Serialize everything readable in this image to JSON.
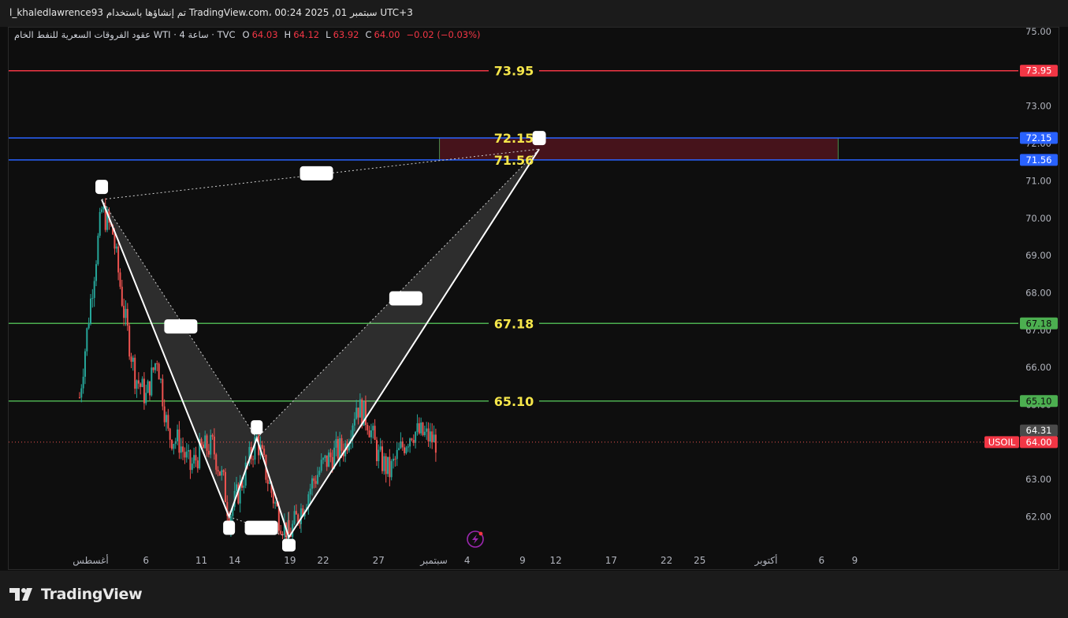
{
  "header": {
    "title_text": "l_khaledlawrence93 تم إنشاؤها باستخدام TradingView.com، 00:24 2025 ,01 سبتمبر UTC+3"
  },
  "legend": {
    "symbol_title": "عقود الفروقات السعرية للنفط الخام WTI · 4 ساعة · TVC",
    "o_label": "O",
    "o_value": "64.03",
    "h_label": "H",
    "h_value": "64.12",
    "l_label": "L",
    "l_value": "63.92",
    "c_label": "C",
    "c_value": "64.00",
    "change": "−0.02 (−0.03%)"
  },
  "footer": {
    "brand": "TradingView"
  },
  "colors": {
    "background": "#0e0e0e",
    "up_candle": "#26a69a",
    "down_candle": "#ef5350",
    "red_level": "#f23645",
    "blue_level": "#2962ff",
    "green_level": "#4caf50",
    "level_label": "#f5e64a",
    "zone_fill": "#5a1620"
  },
  "chart_data": {
    "type": "candlestick",
    "symbol": "USOIL",
    "timeframe": "4h",
    "y_axis": {
      "range": [
        61.3,
        75.4
      ],
      "ticks": [
        "75.00",
        "74.00",
        "73.00",
        "72.00",
        "71.00",
        "70.00",
        "69.00",
        "68.00",
        "67.00",
        "66.00",
        "65.00",
        "64.00",
        "63.00",
        "62.00"
      ]
    },
    "x_axis": {
      "ticks": [
        {
          "label": "أغسطس",
          "day": 1
        },
        {
          "label": "6",
          "day": 6
        },
        {
          "label": "11",
          "day": 11
        },
        {
          "label": "14",
          "day": 14
        },
        {
          "label": "19",
          "day": 19
        },
        {
          "label": "22",
          "day": 22
        },
        {
          "label": "27",
          "day": 27
        },
        {
          "label": "سبتمبر",
          "day": 32
        },
        {
          "label": "4",
          "day": 35
        },
        {
          "label": "9",
          "day": 40
        },
        {
          "label": "12",
          "day": 43
        },
        {
          "label": "17",
          "day": 48
        },
        {
          "label": "22",
          "day": 53
        },
        {
          "label": "25",
          "day": 56
        },
        {
          "label": "أكتوبر",
          "day": 62
        },
        {
          "label": "6",
          "day": 67
        },
        {
          "label": "9",
          "day": 70
        }
      ]
    },
    "levels": [
      {
        "value": 73.95,
        "label": "73.95",
        "kind": "red"
      },
      {
        "value": 72.15,
        "label": "72.15",
        "kind": "blue"
      },
      {
        "value": 71.56,
        "label": "71.56",
        "kind": "blue"
      },
      {
        "value": 67.18,
        "label": "67.18",
        "kind": "green"
      },
      {
        "value": 65.1,
        "label": "65.10",
        "kind": "green"
      }
    ],
    "zone": {
      "day_from": 32.5,
      "day_to": 68.5,
      "low": 71.56,
      "high": 72.15
    },
    "current_price": {
      "symbol": "USOIL",
      "value": "64.00",
      "value_num": 64.0
    },
    "prev_close": {
      "value": "64.31",
      "value_num": 64.31
    },
    "pattern_points": [
      {
        "day": 2.0,
        "price": 70.5
      },
      {
        "day": 13.5,
        "price": 62.0
      },
      {
        "day": 16.0,
        "price": 64.1
      },
      {
        "day": 18.9,
        "price": 61.45
      },
      {
        "day": 41.5,
        "price": 71.85
      }
    ],
    "candle_series": [
      {
        "day": 0.0,
        "close": 65.2
      },
      {
        "day": 1.0,
        "close": 67.8
      },
      {
        "day": 2.0,
        "close": 70.2
      },
      {
        "day": 3.0,
        "close": 69.6
      },
      {
        "day": 4.0,
        "close": 67.5
      },
      {
        "day": 5.0,
        "close": 65.8
      },
      {
        "day": 6.0,
        "close": 65.2
      },
      {
        "day": 7.0,
        "close": 66.3
      },
      {
        "day": 8.0,
        "close": 64.2
      },
      {
        "day": 9.0,
        "close": 64.0
      },
      {
        "day": 10.0,
        "close": 63.3
      },
      {
        "day": 11.0,
        "close": 63.8
      },
      {
        "day": 12.0,
        "close": 63.9
      },
      {
        "day": 13.0,
        "close": 62.9
      },
      {
        "day": 13.5,
        "close": 62.0
      },
      {
        "day": 14.5,
        "close": 62.8
      },
      {
        "day": 16.0,
        "close": 64.1
      },
      {
        "day": 17.0,
        "close": 63.0
      },
      {
        "day": 18.0,
        "close": 62.0
      },
      {
        "day": 18.9,
        "close": 61.5
      },
      {
        "day": 20.0,
        "close": 62.2
      },
      {
        "day": 21.0,
        "close": 62.9
      },
      {
        "day": 22.0,
        "close": 63.4
      },
      {
        "day": 23.0,
        "close": 63.7
      },
      {
        "day": 24.0,
        "close": 63.9
      },
      {
        "day": 25.0,
        "close": 65.0
      },
      {
        "day": 26.0,
        "close": 64.6
      },
      {
        "day": 27.0,
        "close": 63.6
      },
      {
        "day": 28.0,
        "close": 63.2
      },
      {
        "day": 29.0,
        "close": 63.8
      },
      {
        "day": 30.0,
        "close": 64.3
      },
      {
        "day": 31.0,
        "close": 64.2
      },
      {
        "day": 32.3,
        "close": 64.0
      }
    ]
  }
}
